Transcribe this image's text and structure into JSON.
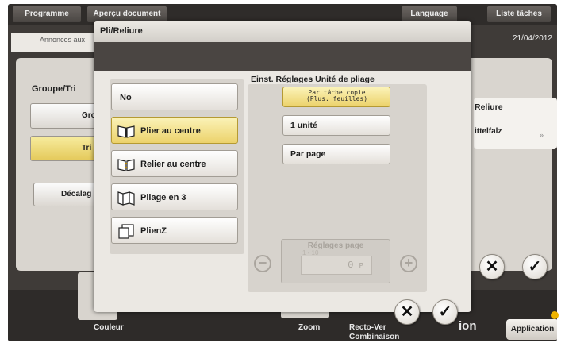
{
  "topbar": {
    "programme": "Programme",
    "apercu": "Aperçu document",
    "language": "Language",
    "liste_taches": "Liste tâches"
  },
  "background": {
    "annonces": "Annonces aux",
    "date": "21/04/2012",
    "groupe_tri_title": "Groupe/Tri",
    "groupe_btn": "Gro",
    "tri_btn": "Tri",
    "decalage_btn": "Décalag",
    "reliure": "Reliure",
    "mittelfalz": "ittelfalz",
    "bottom": {
      "couleur": "Couleur",
      "zoom": "Zoom",
      "recto_verso": "Recto-Ver",
      "combinaison": "Combinaison",
      "application": "Application",
      "tail_text": "ion"
    }
  },
  "dialog": {
    "title": "Pli/Reliure",
    "modes": [
      {
        "label": "No",
        "icon": "none"
      },
      {
        "label": "Plier au centre",
        "icon": "fold-center-icon"
      },
      {
        "label": "Relier au centre",
        "icon": "bind-center-icon"
      },
      {
        "label": "Pliage en 3",
        "icon": "tri-fold-icon"
      },
      {
        "label": "PlienZ",
        "icon": "z-fold-icon"
      }
    ],
    "selected_mode": "Plier au centre",
    "unit_title": "Einst. Réglages Unité de pliage",
    "unit_options": [
      {
        "label_line1": "Par tâche copie",
        "label_line2": "(Plus. feuilles)"
      },
      {
        "label": "1 unité"
      },
      {
        "label": "Par page"
      }
    ],
    "selected_unit": "Par tâche copie",
    "page_settings": {
      "label": "Réglages page",
      "range": "1 - 10",
      "value": "0",
      "unit": "P"
    },
    "cancel_symbol": "✕",
    "ok_symbol": "✓",
    "minus_symbol": "−",
    "plus_symbol": "+"
  },
  "colors": {
    "selected": "#ecd26b",
    "dialog_bg": "#ebe8e3",
    "dark": "#3f3b38"
  }
}
